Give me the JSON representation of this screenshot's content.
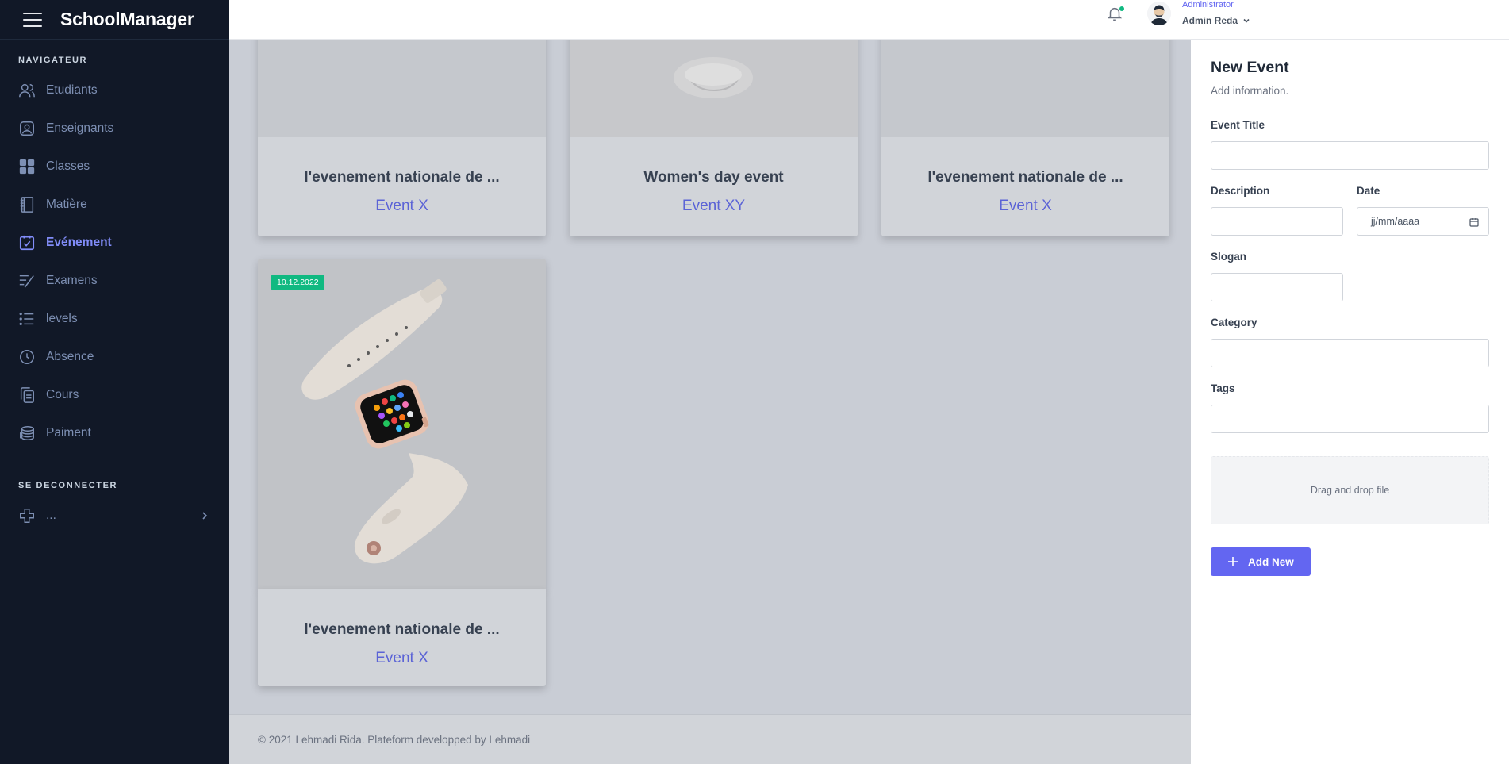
{
  "app": {
    "brand": "SchoolManager"
  },
  "sidebar": {
    "section_nav": "NAVIGATEUR",
    "items": [
      {
        "label": "Etudiants",
        "icon": "users-icon"
      },
      {
        "label": "Enseignants",
        "icon": "user-badge-icon"
      },
      {
        "label": "Classes",
        "icon": "grid-icon"
      },
      {
        "label": "Matière",
        "icon": "book-icon"
      },
      {
        "label": "Evénement",
        "icon": "calendar-check-icon",
        "active": true
      },
      {
        "label": "Examens",
        "icon": "checklist-icon"
      },
      {
        "label": "levels",
        "icon": "list-icon"
      },
      {
        "label": "Absence",
        "icon": "clock-icon"
      },
      {
        "label": "Cours",
        "icon": "copy-icon"
      },
      {
        "label": "Paiment",
        "icon": "coins-icon"
      }
    ],
    "section_logout": "SE DECONNECTER",
    "logout_item": {
      "label": "...",
      "icon": "plus-icon"
    }
  },
  "topbar": {
    "user_role": "Administrator",
    "user_name": "Admin Reda",
    "notification_dot_color": "#10b981"
  },
  "cards": [
    {
      "title": "l'evenement nationale de ...",
      "subtitle": "Event X"
    },
    {
      "title": "Women's day event",
      "subtitle": "Event XY"
    },
    {
      "title": "l'evenement nationale de ...",
      "subtitle": "Event X"
    },
    {
      "title": "l'evenement nationale de ...",
      "subtitle": "Event X",
      "date": "10.12.2022"
    }
  ],
  "footer": {
    "text": "© 2021 Lehmadi Rida. Plateform developped by Lehmadi"
  },
  "panel": {
    "title": "New Event",
    "subtitle": "Add information.",
    "fields": {
      "event_title": {
        "label": "Event Title",
        "value": ""
      },
      "description": {
        "label": "Description",
        "value": ""
      },
      "date": {
        "label": "Date",
        "placeholder": "jj/mm/aaaa"
      },
      "slogan": {
        "label": "Slogan",
        "value": ""
      },
      "category": {
        "label": "Category",
        "value": ""
      },
      "tags": {
        "label": "Tags",
        "value": ""
      }
    },
    "dropzone_text": "Drag and drop file",
    "add_button": "Add New",
    "accent_color": "#6366f1"
  }
}
